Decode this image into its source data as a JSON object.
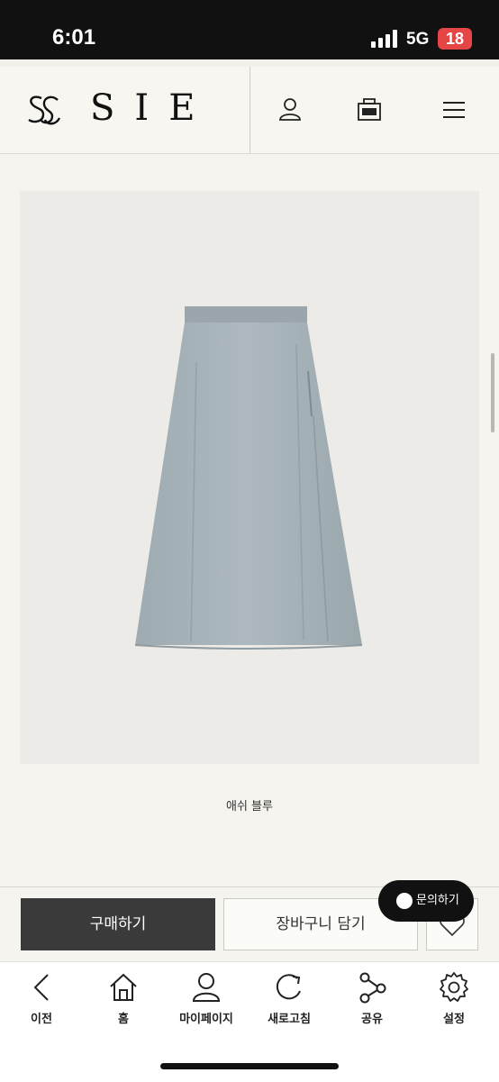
{
  "status_bar": {
    "time": "6:01",
    "network": "5G",
    "battery": "18"
  },
  "header": {
    "brand": "SIE",
    "icons": [
      "user-icon",
      "bag-icon",
      "menu-icon"
    ]
  },
  "product": {
    "color_name": "애쉬 블루",
    "skirt_color": "#a8b4b9"
  },
  "actions": {
    "buy_label": "구매하기",
    "cart_label": "장바구니 담기",
    "inquiry_label": "문의하기"
  },
  "bottom_nav": {
    "items": [
      {
        "label": "이전",
        "icon": "back-icon"
      },
      {
        "label": "홈",
        "icon": "home-icon"
      },
      {
        "label": "마이페이지",
        "icon": "mypage-icon"
      },
      {
        "label": "새로고침",
        "icon": "refresh-icon"
      },
      {
        "label": "공유",
        "icon": "share-icon"
      },
      {
        "label": "설정",
        "icon": "settings-icon"
      }
    ]
  }
}
